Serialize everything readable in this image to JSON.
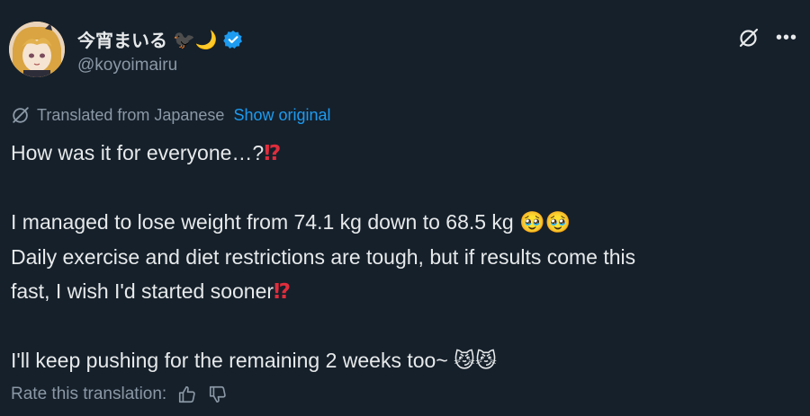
{
  "header": {
    "display_name": "今宵まいる",
    "name_emojis": "🐦‍⬛🌙",
    "handle": "@koyoimairu"
  },
  "translation": {
    "label": "Translated from Japanese",
    "show_original": "Show original"
  },
  "tweet": {
    "line1": "How was it for everyone…?",
    "line1_emoji": "⁉",
    "line2": "I managed to lose weight from 74.1 kg down to 68.5 kg",
    "line2_emoji": "🥹🥹",
    "line3": "Daily exercise and diet restrictions are tough, but if results come this",
    "line4": "fast, I wish I'd started sooner",
    "line4_emoji": "⁉",
    "line5": "I'll keep pushing for the remaining 2 weeks too~",
    "line5_emoji": "😼😼"
  },
  "footer": {
    "rate_label": "Rate this translation:"
  },
  "icons": {
    "verified": "verified-badge-icon",
    "grok": "grok-icon",
    "more": "more-icon",
    "translate": "translate-icon",
    "thumbs_up": "thumbs-up-icon",
    "thumbs_down": "thumbs-down-icon"
  },
  "colors": {
    "background": "#15202b",
    "link": "#1d9bf0",
    "secondary_text": "#8b98a5",
    "primary_text": "#e7e9ea",
    "accent_red": "#e02d3c"
  }
}
